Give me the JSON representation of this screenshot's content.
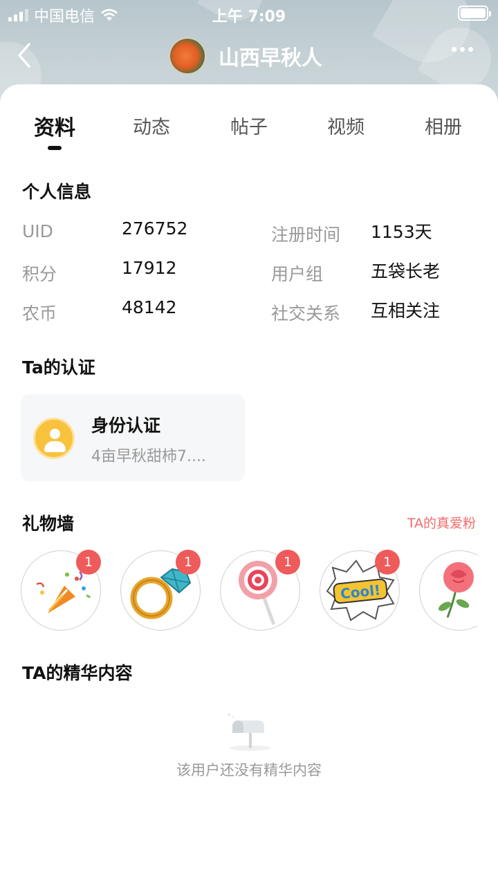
{
  "status_bar": {
    "carrier": "中国电信",
    "time": "上午 7:09"
  },
  "nav": {
    "title": "山西早秋人"
  },
  "tabs": [
    {
      "label": "资料",
      "active": true
    },
    {
      "label": "动态",
      "active": false
    },
    {
      "label": "帖子",
      "active": false
    },
    {
      "label": "视频",
      "active": false
    },
    {
      "label": "相册",
      "active": false
    }
  ],
  "personal_info": {
    "title": "个人信息",
    "rows": [
      {
        "label": "UID",
        "value": "276752",
        "label2": "注册时间",
        "value2": "1153天"
      },
      {
        "label": "积分",
        "value": "17912",
        "label2": "用户组",
        "value2": "五袋长老"
      },
      {
        "label": "农币",
        "value": "48142",
        "label2": "社交关系",
        "value2": "互相关注"
      }
    ]
  },
  "certification": {
    "title": "Ta的认证",
    "card_title": "身份认证",
    "card_desc": "4亩早秋甜柿7...."
  },
  "gift_wall": {
    "title": "礼物墙",
    "link": "TA的真爱粉",
    "gifts": [
      {
        "name": "party-popper",
        "count": "1"
      },
      {
        "name": "diamond-ring",
        "count": "1"
      },
      {
        "name": "lollipop",
        "count": "1"
      },
      {
        "name": "cool-sticker",
        "count": "1"
      },
      {
        "name": "rose",
        "count": ""
      }
    ]
  },
  "featured": {
    "title": "TA的精华内容",
    "empty_text": "该用户还没有精华内容"
  },
  "colors": {
    "accent_red": "#ef5a5a",
    "link_red": "#f26b6b",
    "cert_yellow": "#f9c23c"
  }
}
